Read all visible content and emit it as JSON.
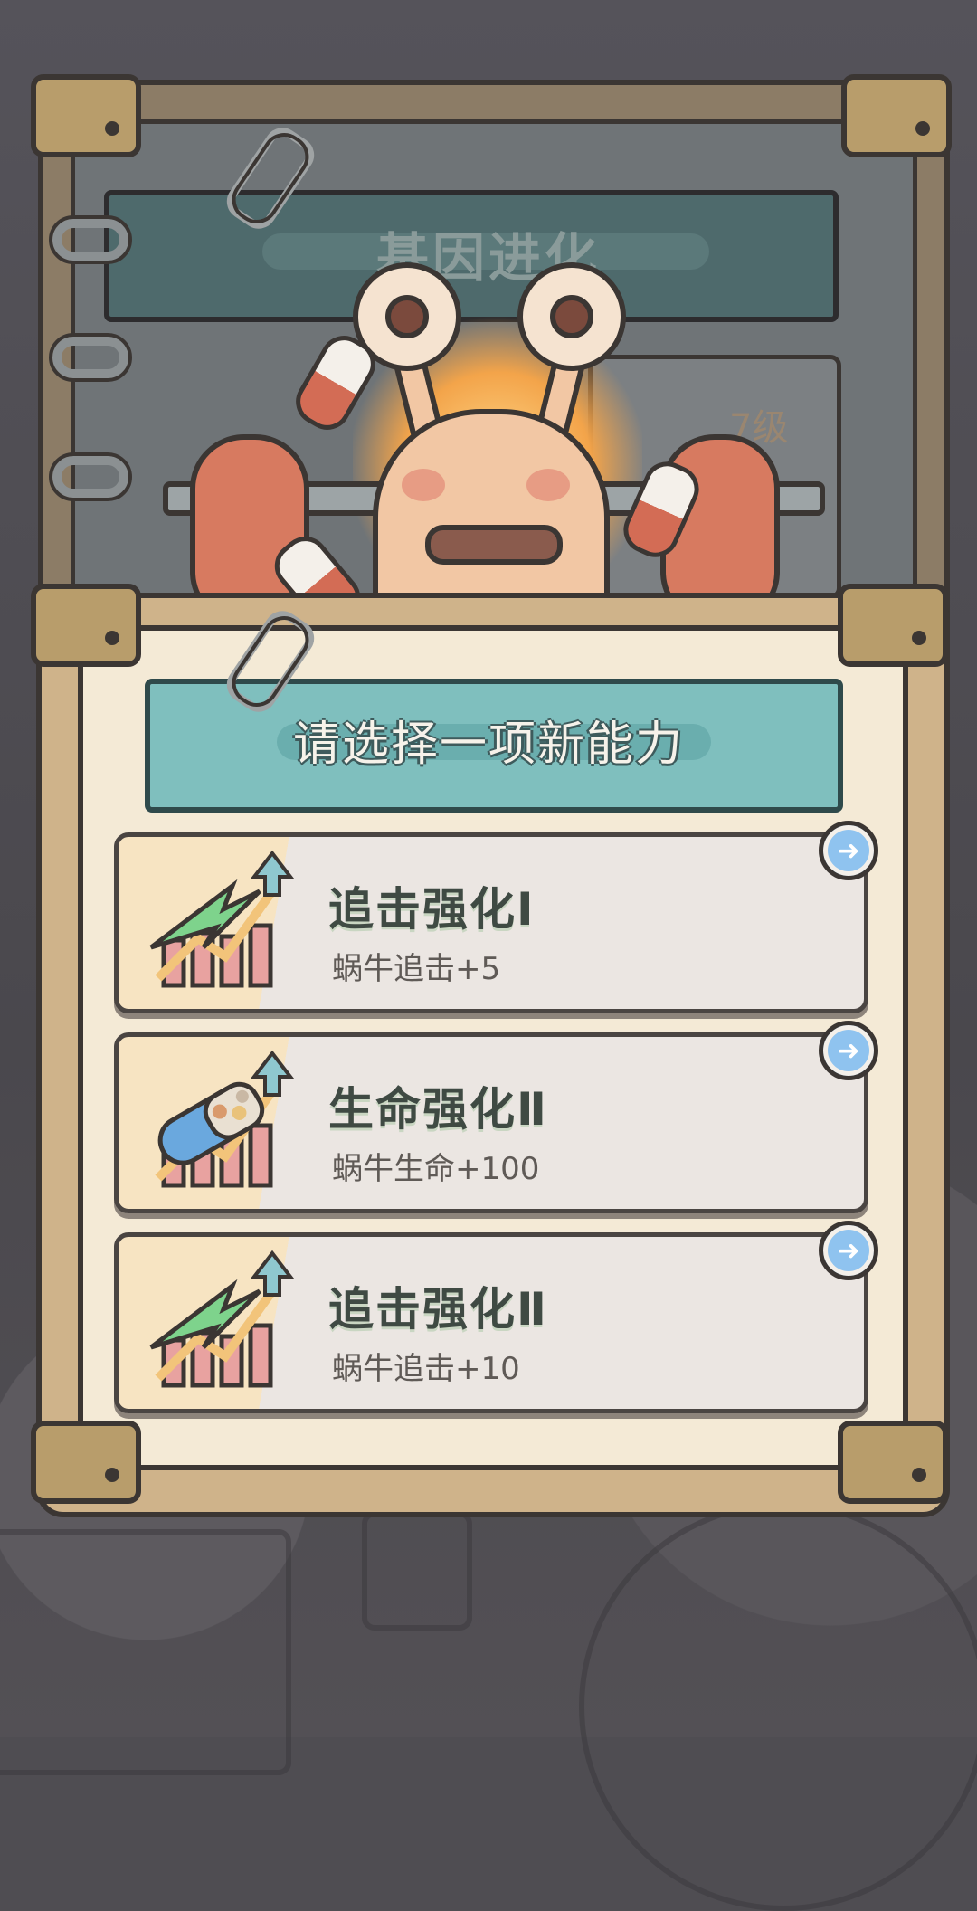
{
  "background_panel": {
    "title": "基因进化",
    "level_badge": "7级"
  },
  "main_panel": {
    "title": "请选择一项新能力",
    "options": [
      {
        "name": "追击强化Ⅰ",
        "desc": "蜗牛追击+5",
        "icon": "lightning-chart-icon",
        "action_icon": "arrow-right-icon"
      },
      {
        "name": "生命强化Ⅱ",
        "desc": "蜗牛生命+100",
        "icon": "capsule-chart-icon",
        "action_icon": "arrow-right-icon"
      },
      {
        "name": "追击强化Ⅱ",
        "desc": "蜗牛追击+10",
        "icon": "lightning-chart-icon",
        "action_icon": "arrow-right-icon"
      }
    ]
  },
  "colors": {
    "panel": "#cfb38a",
    "panel_inner": "#f4ead6",
    "title_bar": "#7fbfbe",
    "arrow_button": "#8fc3ef",
    "lightning": "#7ed38c",
    "capsule": "#6aa8de"
  }
}
